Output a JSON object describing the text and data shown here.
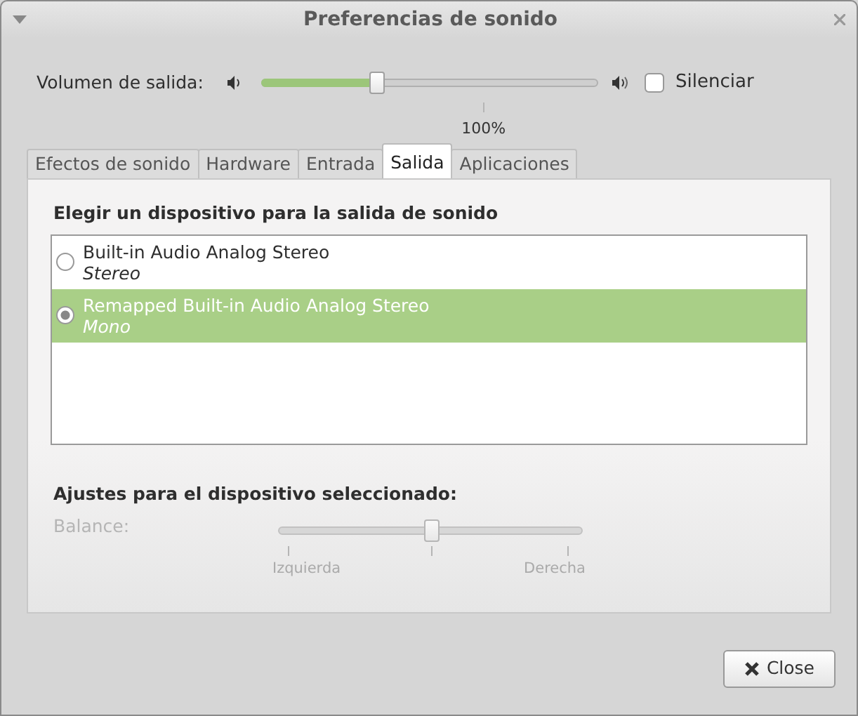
{
  "window": {
    "title": "Preferencias de sonido"
  },
  "volume": {
    "label": "Volumen de salida:",
    "level": 0.34,
    "tick_label": "100%",
    "mute": {
      "label": "Silenciar",
      "checked": false
    }
  },
  "tabs": [
    {
      "label": "Efectos de sonido",
      "selected": false
    },
    {
      "label": "Hardware",
      "selected": false
    },
    {
      "label": "Entrada",
      "selected": false
    },
    {
      "label": "Salida",
      "selected": true
    },
    {
      "label": "Aplicaciones",
      "selected": false
    }
  ],
  "output": {
    "heading": "Elegir un dispositivo para la salida de sonido",
    "devices": [
      {
        "name": "Built-in Audio Analog Stereo",
        "profile": "Stereo",
        "selected": false
      },
      {
        "name": "Remapped Built-in Audio Analog Stereo",
        "profile": "Mono",
        "selected": true
      }
    ]
  },
  "settings": {
    "heading": "Ajustes para el dispositivo seleccionado:",
    "balance": {
      "label": "Balance:",
      "disabled": true,
      "level": 0.5,
      "left_label": "Izquierda",
      "right_label": "Derecha"
    }
  },
  "buttons": [
    {
      "label": "Close"
    }
  ]
}
